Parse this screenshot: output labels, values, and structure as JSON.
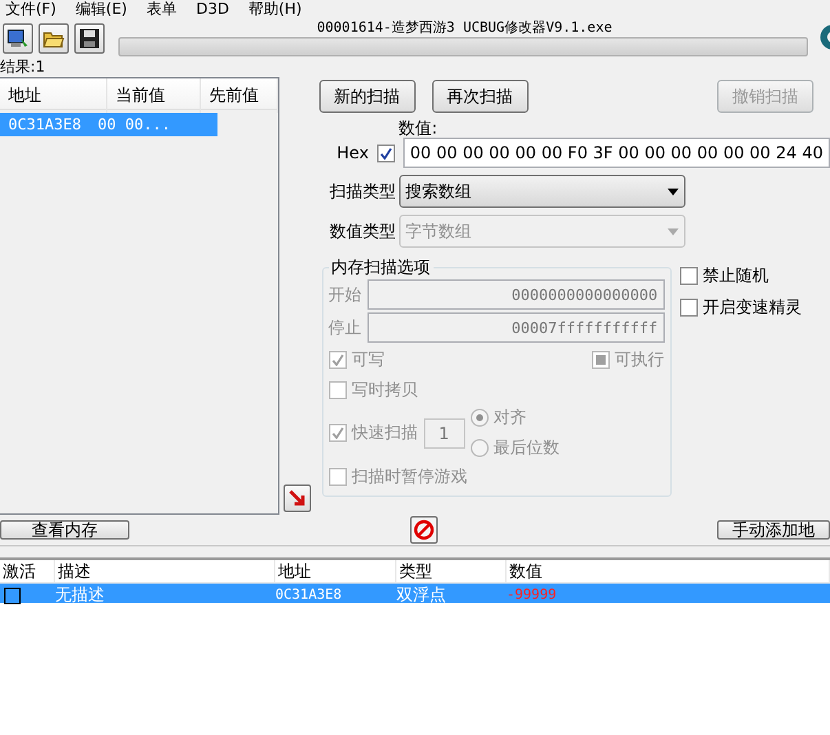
{
  "menu": [
    "文件(F)",
    "编辑(E)",
    "表单",
    "D3D",
    "帮助(H)"
  ],
  "title": "00001614-造梦西游3 UCBUG修改器V9.1.exe",
  "progress": {
    "level": 0
  },
  "results_label": "结果:1",
  "results_table": {
    "columns": [
      "地址",
      "当前值",
      "先前值"
    ],
    "rows": [
      {
        "cells": [
          "0C31A3E8",
          "00 00..."
        ],
        "selected": true
      }
    ]
  },
  "scan_buttons": [
    {
      "label": "新的扫描",
      "disabled": false
    },
    {
      "label": "再次扫描",
      "disabled": false
    },
    {
      "label": "撤销扫描",
      "disabled": true
    }
  ],
  "value": {
    "label": "数值:",
    "hex_label": "Hex",
    "hex_checked": true,
    "value": "00 00 00 00 00 00 F0 3F 00 00 00 00 00 00 24 40"
  },
  "selects": [
    {
      "label": "扫描类型",
      "value": "搜索数组",
      "disabled": false
    },
    {
      "label": "数值类型",
      "value": "字节数组",
      "disabled": true
    }
  ],
  "memory_options": {
    "title": "内存扫描选项",
    "disabled": true,
    "ranges": [
      {
        "label": "开始",
        "value": "0000000000000000"
      },
      {
        "label": "停止",
        "value": "00007fffffffffff"
      }
    ],
    "writable": {
      "label": "可写",
      "checked": true
    },
    "executable": {
      "label": "可执行",
      "indeterminate": true
    },
    "copy_on_write": {
      "label": "写时拷贝",
      "checked": false
    },
    "fast_scan": {
      "label": "快速扫描",
      "checked": true,
      "value": "1"
    },
    "alignment": [
      {
        "label": "对齐",
        "selected": true
      },
      {
        "label": "最后位数",
        "selected": false
      }
    ],
    "pause_game": {
      "label": "扫描时暂停游戏",
      "checked": false
    }
  },
  "extra_options": [
    {
      "label": "禁止随机",
      "checked": false
    },
    {
      "label": "开启变速精灵",
      "checked": false
    }
  ],
  "view_memory": "查看内存",
  "add_address": "手动添加地",
  "cheat_table": {
    "columns": [
      "激活",
      "描述",
      "地址",
      "类型",
      "数值"
    ],
    "rows": [
      {
        "active": false,
        "description": "无描述",
        "address": "0C31A3E8",
        "type": "双浮点",
        "value": "-99999",
        "selected": true
      }
    ]
  }
}
